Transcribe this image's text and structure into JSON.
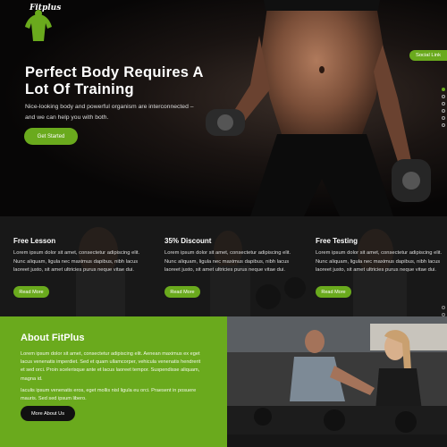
{
  "brand": {
    "logo_text": "Fitplus"
  },
  "hero": {
    "title": "Perfect Body Requires A Lot Of Training",
    "subtitle": "Nice-looking body and powerful organism are interconnected – and we can help you with both.",
    "cta": "Get Started",
    "social_link": "Social Link",
    "slide_dots": 6,
    "active_dot": 0
  },
  "features": [
    {
      "title": "Free Lesson",
      "text": "Lorem ipsum dolor sit amet, consectetur adipiscing elit. Nunc aliquam, ligula nec maximus dapibus, nibh lacus laoreet justo, sit amet ultricies purus neque vitae dui.",
      "button": "Read More"
    },
    {
      "title": "35% Discount",
      "text": "Lorem ipsum dolor sit amet, consectetur adipiscing elit. Nunc aliquam, ligula nec maximus dapibus, nibh lacus laoreet justo, sit amet ultricies purus neque vitae dui.",
      "button": "Read More"
    },
    {
      "title": "Free Testing",
      "text": "Lorem ipsum dolor sit amet, consectetur adipiscing elit. Nunc aliquam, ligula nec maximus dapibus, nibh lacus laoreet justo, sit amet ultricies purus neque vitae dui.",
      "button": "Read More"
    }
  ],
  "about": {
    "title": "About FitPlus",
    "paragraph1": "Lorem ipsum dolor sit amet, consectetur adipiscing elit. Aenean maximus ex eget lacus venenatis imperdiet. Sed et quam ullamcorper, vehicula venenatis hendrerit et sed orci. Proin scelerisque ante et lacus laoreet tempor. Suspendisse aliquam, magna id.",
    "paragraph2": "Iaculis ipsum venenatis eros, eget mollis nisl ligula eu orci. Praesent in posuere mauris. Sed sed ipsum libero.",
    "button": "More About Us"
  },
  "colors": {
    "accent": "#6aaa1d",
    "dark": "#111111"
  }
}
